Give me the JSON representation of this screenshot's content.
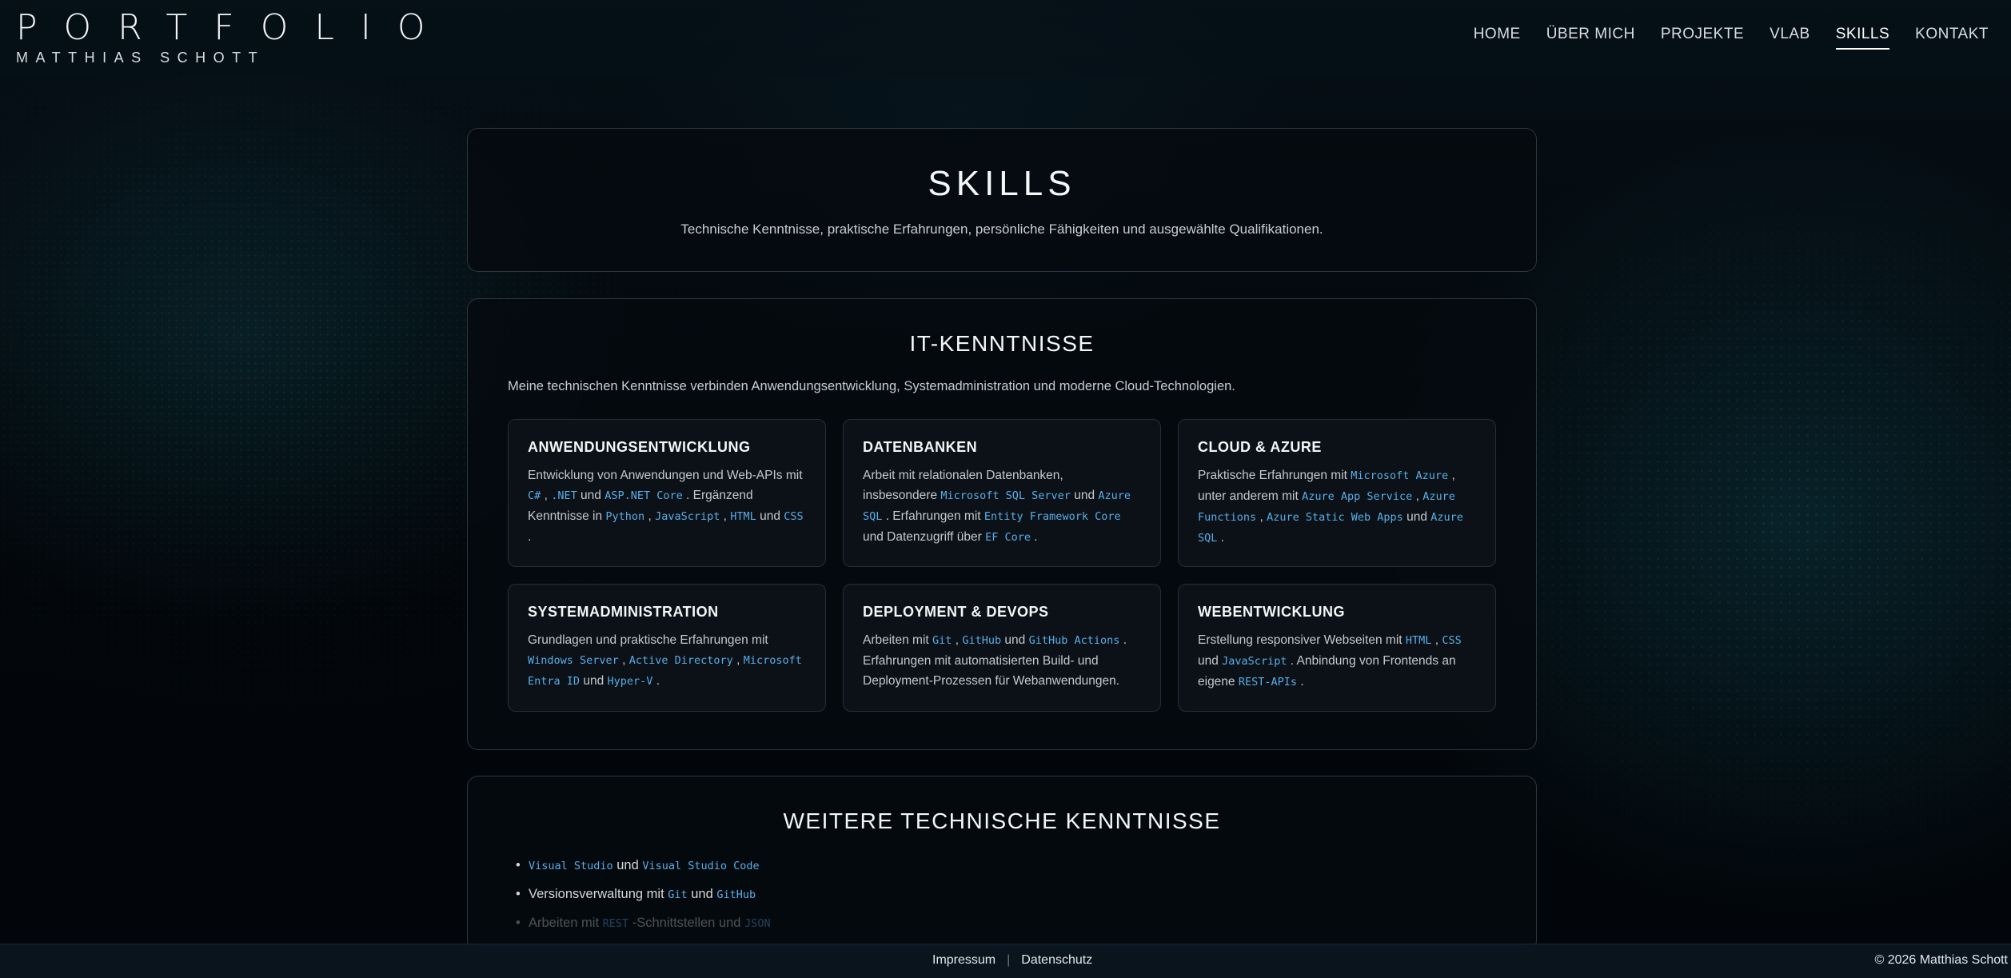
{
  "brand": {
    "title": "PORTFOLIO",
    "subtitle": "MATTHIAS SCHOTT"
  },
  "nav": [
    {
      "label": "HOME",
      "active": false
    },
    {
      "label": "ÜBER MICH",
      "active": false
    },
    {
      "label": "PROJEKTE",
      "active": false
    },
    {
      "label": "VLAB",
      "active": false
    },
    {
      "label": "SKILLS",
      "active": true
    },
    {
      "label": "KONTAKT",
      "active": false
    }
  ],
  "hero": {
    "title": "SKILLS",
    "subtitle": "Technische Kenntnisse, praktische Erfahrungen, persönliche Fähigkeiten und ausgewählte Qualifikationen."
  },
  "it": {
    "title": "IT-KENNTNISSE",
    "intro": "Meine technischen Kenntnisse verbinden Anwendungsentwicklung, Systemadministration und moderne Cloud-Technologien.",
    "cards": [
      {
        "title": "ANWENDUNGSENTWICKLUNG",
        "parts": [
          {
            "t": "Entwicklung von Anwendungen und Web-APIs mit "
          },
          {
            "c": "C#"
          },
          {
            "t": " , "
          },
          {
            "c": ".NET"
          },
          {
            "t": " und "
          },
          {
            "c": "ASP.NET Core"
          },
          {
            "t": " . Ergänzend Kenntnisse in "
          },
          {
            "c": "Python"
          },
          {
            "t": " , "
          },
          {
            "c": "JavaScript"
          },
          {
            "t": " , "
          },
          {
            "c": "HTML"
          },
          {
            "t": " und "
          },
          {
            "c": "CSS"
          },
          {
            "t": " ."
          }
        ]
      },
      {
        "title": "DATENBANKEN",
        "parts": [
          {
            "t": "Arbeit mit relationalen Datenbanken, insbesondere "
          },
          {
            "c": "Microsoft SQL Server"
          },
          {
            "t": " und "
          },
          {
            "c": "Azure SQL"
          },
          {
            "t": " . Erfahrungen mit "
          },
          {
            "c": "Entity Framework Core"
          },
          {
            "t": " und Datenzugriff über "
          },
          {
            "c": "EF Core"
          },
          {
            "t": " ."
          }
        ]
      },
      {
        "title": "CLOUD & AZURE",
        "parts": [
          {
            "t": "Praktische Erfahrungen mit "
          },
          {
            "c": "Microsoft Azure"
          },
          {
            "t": " , unter anderem mit "
          },
          {
            "c": "Azure App Service"
          },
          {
            "t": " , "
          },
          {
            "c": "Azure Functions"
          },
          {
            "t": " , "
          },
          {
            "c": "Azure Static Web Apps"
          },
          {
            "t": " und "
          },
          {
            "c": "Azure SQL"
          },
          {
            "t": " ."
          }
        ]
      },
      {
        "title": "SYSTEMADMINISTRATION",
        "parts": [
          {
            "t": "Grundlagen und praktische Erfahrungen mit "
          },
          {
            "c": "Windows Server"
          },
          {
            "t": " , "
          },
          {
            "c": "Active Directory"
          },
          {
            "t": " , "
          },
          {
            "c": "Microsoft Entra ID"
          },
          {
            "t": " und "
          },
          {
            "c": "Hyper-V"
          },
          {
            "t": " ."
          }
        ]
      },
      {
        "title": "DEPLOYMENT & DEVOPS",
        "parts": [
          {
            "t": "Arbeiten mit "
          },
          {
            "c": "Git"
          },
          {
            "t": " , "
          },
          {
            "c": "GitHub"
          },
          {
            "t": " und "
          },
          {
            "c": "GitHub Actions"
          },
          {
            "t": " . Erfahrungen mit automatisierten Build- und Deployment-Prozessen für Webanwendungen."
          }
        ]
      },
      {
        "title": "WEBENTWICKLUNG",
        "parts": [
          {
            "t": "Erstellung responsiver Webseiten mit "
          },
          {
            "c": "HTML"
          },
          {
            "t": " , "
          },
          {
            "c": "CSS"
          },
          {
            "t": " und "
          },
          {
            "c": "JavaScript"
          },
          {
            "t": " . Anbindung von Frontends an eigene "
          },
          {
            "c": "REST-APIs"
          },
          {
            "t": " ."
          }
        ]
      }
    ]
  },
  "more": {
    "title": "WEITERE TECHNISCHE KENNTNISSE",
    "items": [
      {
        "parts": [
          {
            "c": "Visual Studio"
          },
          {
            "t": " und "
          },
          {
            "c": "Visual Studio Code"
          }
        ]
      },
      {
        "parts": [
          {
            "t": "Versionsverwaltung mit "
          },
          {
            "c": "Git"
          },
          {
            "t": " und "
          },
          {
            "c": "GitHub"
          }
        ]
      },
      {
        "parts": [
          {
            "t": "Arbeiten mit "
          },
          {
            "c": "REST"
          },
          {
            "t": " -Schnittstellen und "
          },
          {
            "c": "JSON"
          }
        ]
      }
    ]
  },
  "footer": {
    "impressum": "Impressum",
    "separator": "|",
    "datenschutz": "Datenschutz",
    "copyright": "© 2026 Matthias Schott"
  },
  "colors": {
    "accent_code": "#58aeea",
    "background": "#03070b"
  }
}
